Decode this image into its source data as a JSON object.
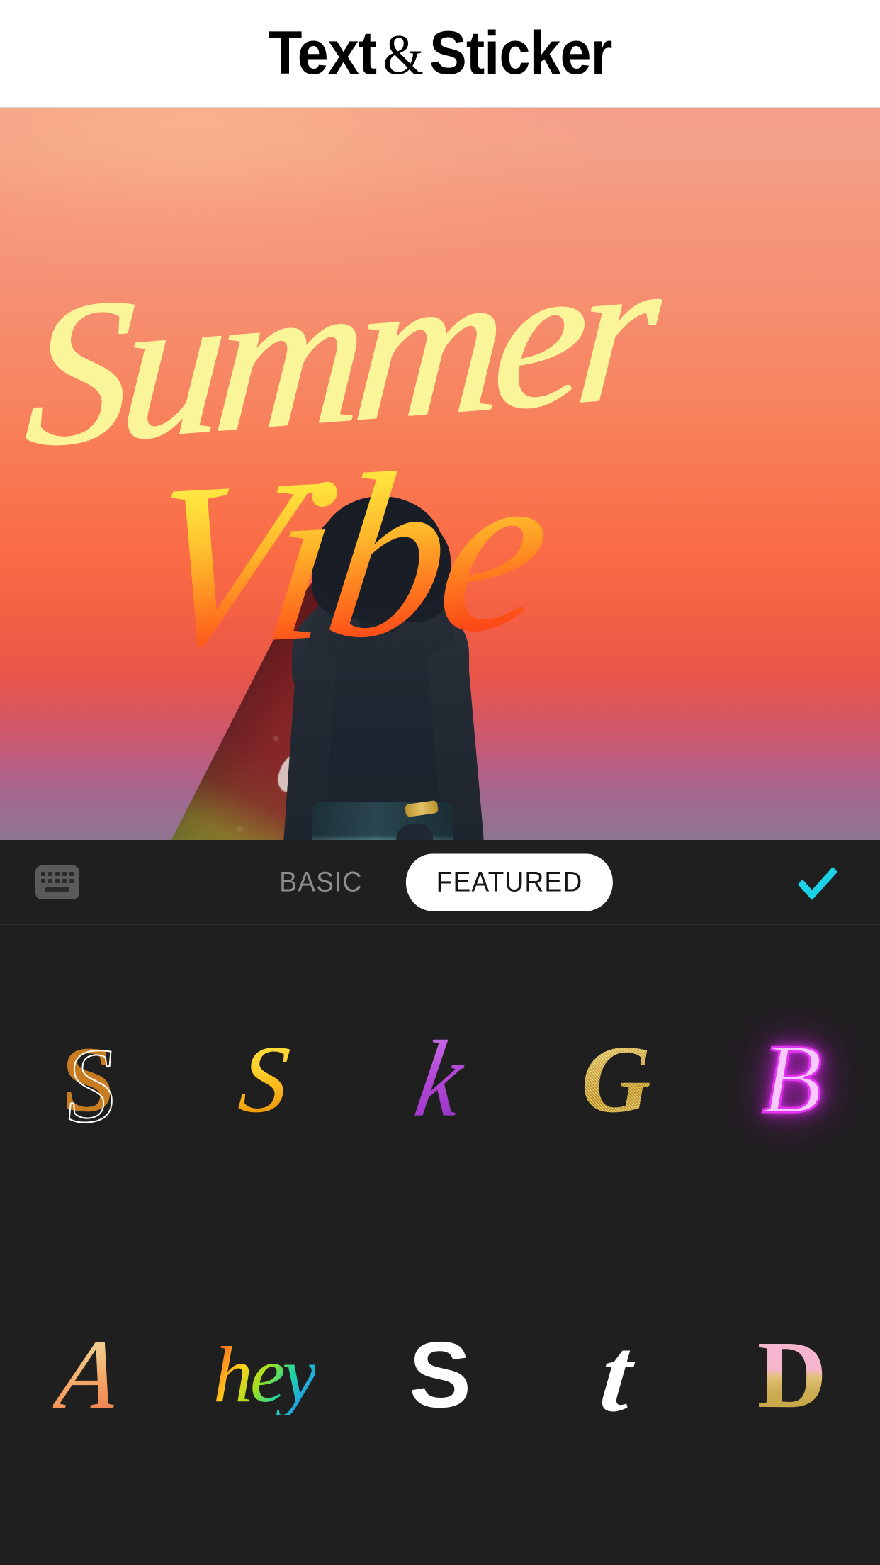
{
  "header": {
    "title_part1": "Text",
    "amp": "&",
    "title_part2": "Sticker",
    "full_title": "Text & Sticker"
  },
  "canvas": {
    "photo_description": "Surfer at sunset beach",
    "stickers": [
      {
        "text": "Summer",
        "color": "#FBF59A",
        "style": "brush-script"
      },
      {
        "text": "Vibe",
        "color_top": "#FFF05E",
        "color_bottom": "#F43A16",
        "style": "brush-script-gradient"
      }
    ],
    "scene_colors": {
      "sky_top": "#F4A08B",
      "sky_mid": "#F9764F",
      "sky_bottom": "#8D7490",
      "sun": "#FFF8DC",
      "board_red": "#8A2126",
      "board_yellow": "#8E7A2E",
      "board_green": "#2F7F52",
      "shorts": "#2C4853"
    }
  },
  "toolbar": {
    "keyboard_icon": "keyboard-icon",
    "tabs": [
      {
        "label": "BASIC",
        "active": false
      },
      {
        "label": "FEATURED",
        "active": true
      }
    ],
    "done_icon": "check-icon",
    "done_color": "#1AD1E8",
    "active_tab_bg": "#FFFFFF",
    "inactive_tab_color": "#8E8E8E"
  },
  "font_grid": {
    "panel_bg": "#1F1F1F",
    "items": [
      {
        "id": "font-1",
        "glyph": "S",
        "style_name": "orange-outline-script",
        "colors": [
          "#C87C22",
          "#FFFFFF"
        ]
      },
      {
        "id": "font-2",
        "glyph": "S",
        "style_name": "gold-ribbon-script",
        "colors": [
          "#FFE14A",
          "#E08A06"
        ]
      },
      {
        "id": "font-3",
        "glyph": "k",
        "style_name": "purple-brush-script",
        "colors": [
          "#D07BE8",
          "#8F2FC0"
        ]
      },
      {
        "id": "font-4",
        "glyph": "G",
        "style_name": "gold-glitter-script",
        "colors": [
          "#F3DD93",
          "#C9A33F"
        ]
      },
      {
        "id": "font-5",
        "glyph": "B",
        "style_name": "magenta-neon-script",
        "colors": [
          "#F8C9FF",
          "#E235F2"
        ]
      },
      {
        "id": "font-6",
        "glyph": "A",
        "style_name": "peach-gradient-brush",
        "colors": [
          "#E8D9A8",
          "#E87A4F"
        ]
      },
      {
        "id": "font-7",
        "glyph": "hey",
        "style_name": "rainbow-handwriting",
        "colors": [
          "#FF2D2D",
          "#2F6FE0"
        ]
      },
      {
        "id": "font-8",
        "glyph": "S",
        "style_name": "glitch-rgb-split",
        "colors": [
          "#FFFFFF",
          "#FF00D4",
          "#00E5FF"
        ]
      },
      {
        "id": "font-9",
        "glyph": "t",
        "style_name": "white-bold-italic",
        "colors": [
          "#FFFFFF"
        ]
      },
      {
        "id": "font-10",
        "glyph": "D",
        "style_name": "pink-gold-dipped",
        "colors": [
          "#F7B7CF",
          "#B99A3E"
        ]
      }
    ]
  }
}
